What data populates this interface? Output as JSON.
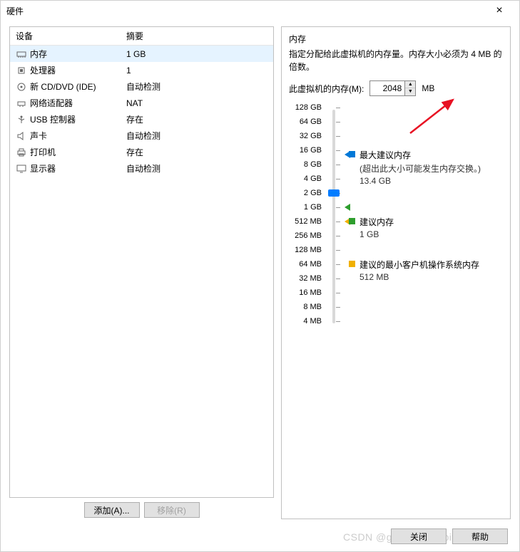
{
  "title": "硬件",
  "columns": {
    "device": "设备",
    "summary": "摘要"
  },
  "devices": [
    {
      "icon": "memory",
      "name": "内存",
      "summary": "1 GB",
      "selected": true
    },
    {
      "icon": "cpu",
      "name": "处理器",
      "summary": "1"
    },
    {
      "icon": "cd",
      "name": "新 CD/DVD (IDE)",
      "summary": "自动检测"
    },
    {
      "icon": "net",
      "name": "网络适配器",
      "summary": "NAT"
    },
    {
      "icon": "usb",
      "name": "USB 控制器",
      "summary": "存在"
    },
    {
      "icon": "sound",
      "name": "声卡",
      "summary": "自动检测"
    },
    {
      "icon": "printer",
      "name": "打印机",
      "summary": "存在"
    },
    {
      "icon": "display",
      "name": "显示器",
      "summary": "自动检测"
    }
  ],
  "buttons": {
    "add": "添加(A)...",
    "remove": "移除(R)",
    "close": "关闭",
    "help": "帮助"
  },
  "mem": {
    "section": "内存",
    "desc": "指定分配给此虚拟机的内存量。内存大小必须为 4 MB 的倍数。",
    "label": "此虚拟机的内存(M):",
    "value": "2048",
    "unit": "MB",
    "ticks": [
      "128 GB",
      "64 GB",
      "32 GB",
      "16 GB",
      "8 GB",
      "4 GB",
      "2 GB",
      "1 GB",
      "512 MB",
      "256 MB",
      "128 MB",
      "64 MB",
      "32 MB",
      "16 MB",
      "8 MB",
      "4 MB"
    ],
    "markers": {
      "max": {
        "title": "最大建议内存",
        "note": "(超出此大小可能发生内存交换。)",
        "value": "13.4 GB",
        "color": "#0078d7"
      },
      "rec": {
        "title": "建议内存",
        "value": "1 GB",
        "color": "#2e9e2e"
      },
      "min": {
        "title": "建议的最小客户机操作系统内存",
        "value": "512 MB",
        "color": "#f0b000"
      }
    }
  },
  "watermark": "CSDN @grumpy_rabbit"
}
